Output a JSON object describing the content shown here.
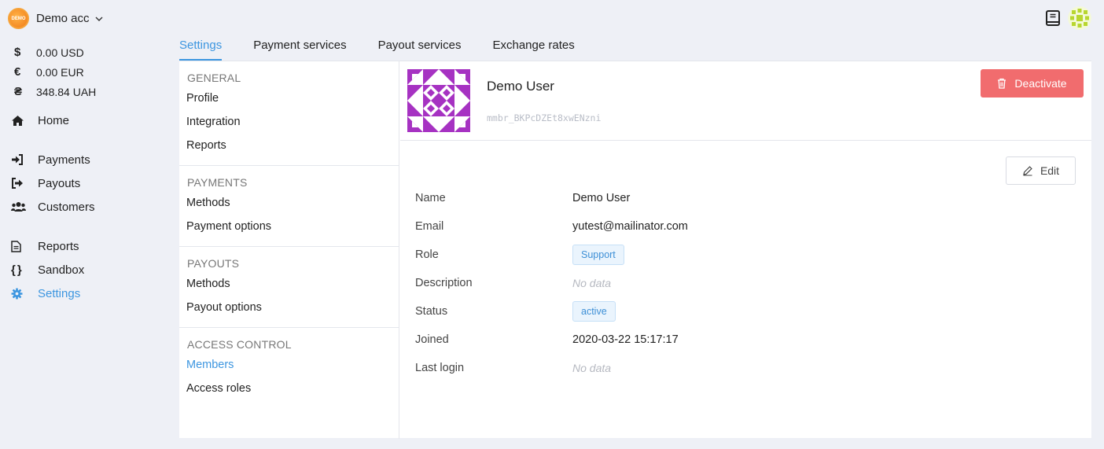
{
  "account": {
    "logo_text": "DEMO",
    "name": "Demo acc"
  },
  "balances": [
    {
      "symbol": "$",
      "amount": "0.00 USD"
    },
    {
      "symbol": "€",
      "amount": "0.00 EUR"
    },
    {
      "symbol": "₴",
      "amount": "348.84 UAH"
    }
  ],
  "nav": {
    "home": "Home",
    "payments": "Payments",
    "payouts": "Payouts",
    "customers": "Customers",
    "reports": "Reports",
    "sandbox": "Sandbox",
    "settings": "Settings"
  },
  "tabs": [
    "Settings",
    "Payment services",
    "Payout services",
    "Exchange rates"
  ],
  "submenu": {
    "general": {
      "title": "GENERAL",
      "items": [
        "Profile",
        "Integration",
        "Reports"
      ]
    },
    "payments": {
      "title": "PAYMENTS",
      "items": [
        "Methods",
        "Payment options"
      ]
    },
    "payouts": {
      "title": "PAYOUTS",
      "items": [
        "Methods",
        "Payout options"
      ]
    },
    "access": {
      "title": "ACCESS CONTROL",
      "items": [
        "Members",
        "Access roles"
      ]
    }
  },
  "profile": {
    "name": "Demo User",
    "id": "mmbr_BKPcDZEt8xwENzni",
    "deactivate_label": "Deactivate",
    "edit_label": "Edit"
  },
  "details": {
    "name_label": "Name",
    "name_value": "Demo User",
    "email_label": "Email",
    "email_value": "yutest@mailinator.com",
    "role_label": "Role",
    "role_value": "Support",
    "description_label": "Description",
    "description_value": "No data",
    "status_label": "Status",
    "status_value": "active",
    "joined_label": "Joined",
    "joined_value": "2020-03-22 15:17:17",
    "last_login_label": "Last login",
    "last_login_value": "No data"
  },
  "colors": {
    "accent": "#3d96e0",
    "danger": "#f16c6e",
    "avatar": "#a632c2"
  }
}
